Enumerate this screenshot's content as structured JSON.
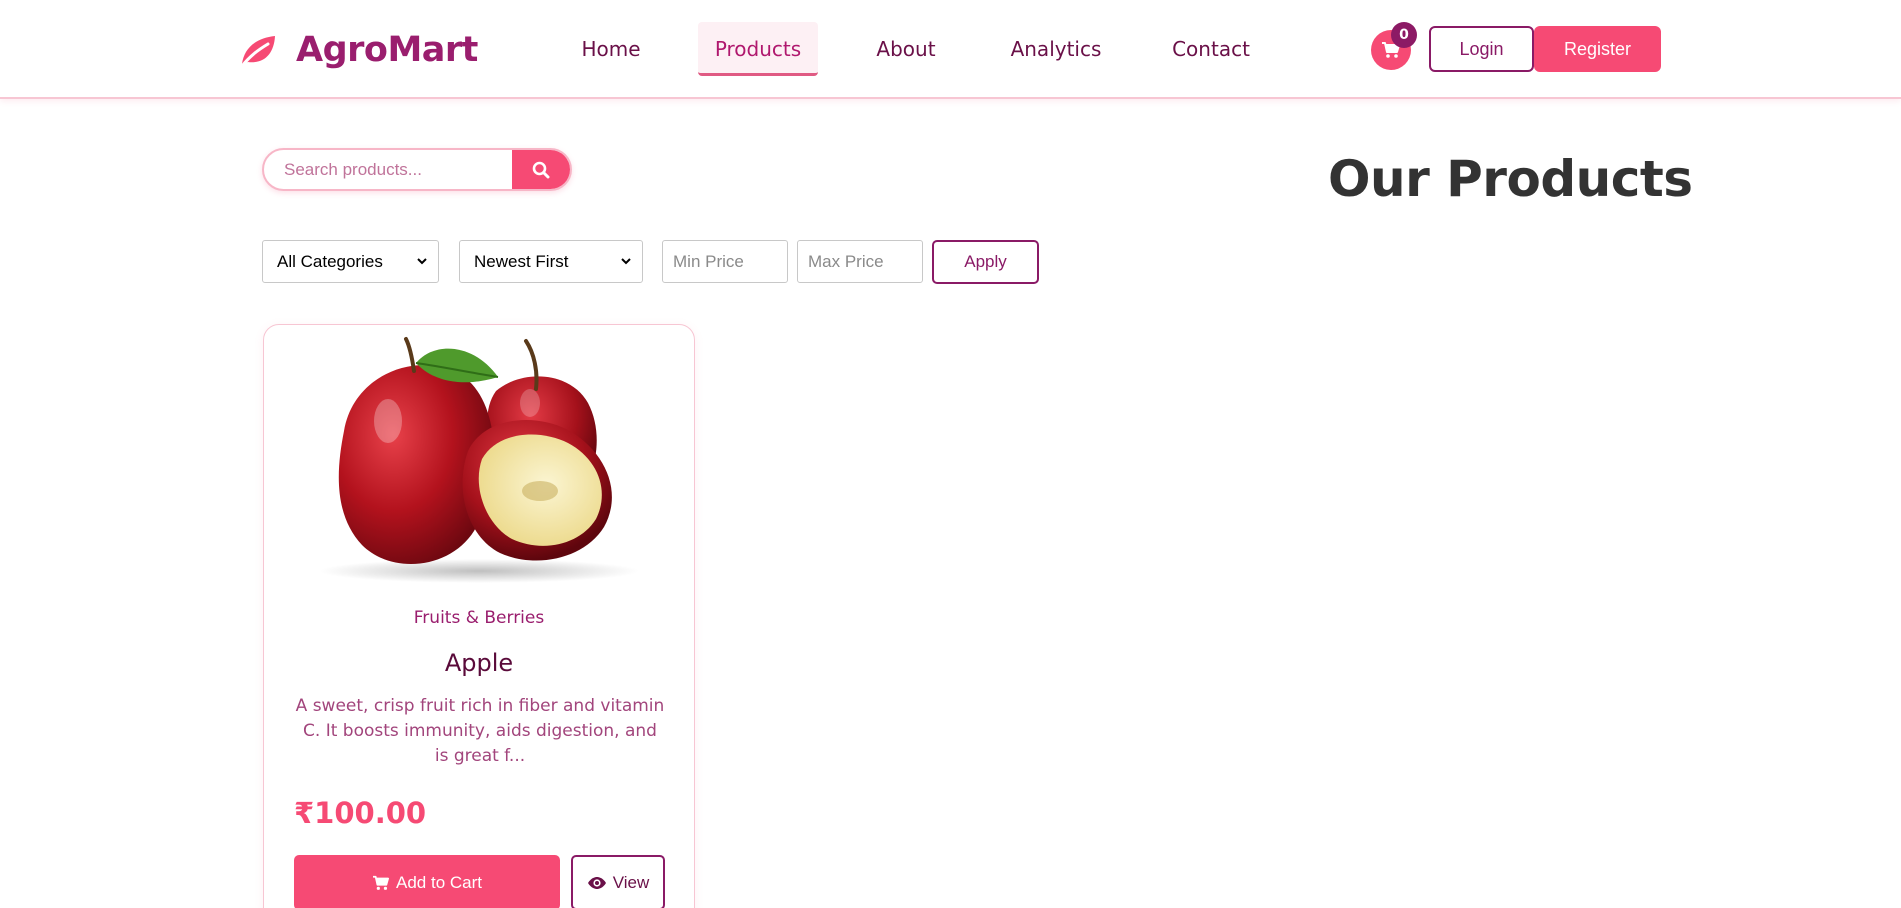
{
  "brand": {
    "name": "AgroMart",
    "icon": "leaf-icon"
  },
  "nav": {
    "home": "Home",
    "products": "Products",
    "about": "About",
    "analytics": "Analytics",
    "contact": "Contact",
    "active": "Products"
  },
  "header": {
    "cart_icon": "cart-icon",
    "cart_count": "0",
    "login_label": "Login",
    "register_label": "Register"
  },
  "search": {
    "placeholder": "Search products...",
    "icon": "search-icon"
  },
  "page_title": "Our Products",
  "filters": {
    "category_selected": "All Categories",
    "sort_selected": "Newest First",
    "min_price_placeholder": "Min Price",
    "max_price_placeholder": "Max Price",
    "apply_label": "Apply"
  },
  "products": [
    {
      "category": "Fruits & Berries",
      "name": "Apple",
      "description": "A sweet, crisp fruit rich in fiber and vitamin C. It boosts immunity, aids digestion, and is great f...",
      "price": "₹100.00",
      "add_to_cart_label": "Add to Cart",
      "view_label": "View"
    }
  ],
  "colors": {
    "primary_pink": "#f64a74",
    "brand_purple": "#9a1e6e",
    "dark_purple": "#6a1048",
    "title_text": "#333333"
  }
}
